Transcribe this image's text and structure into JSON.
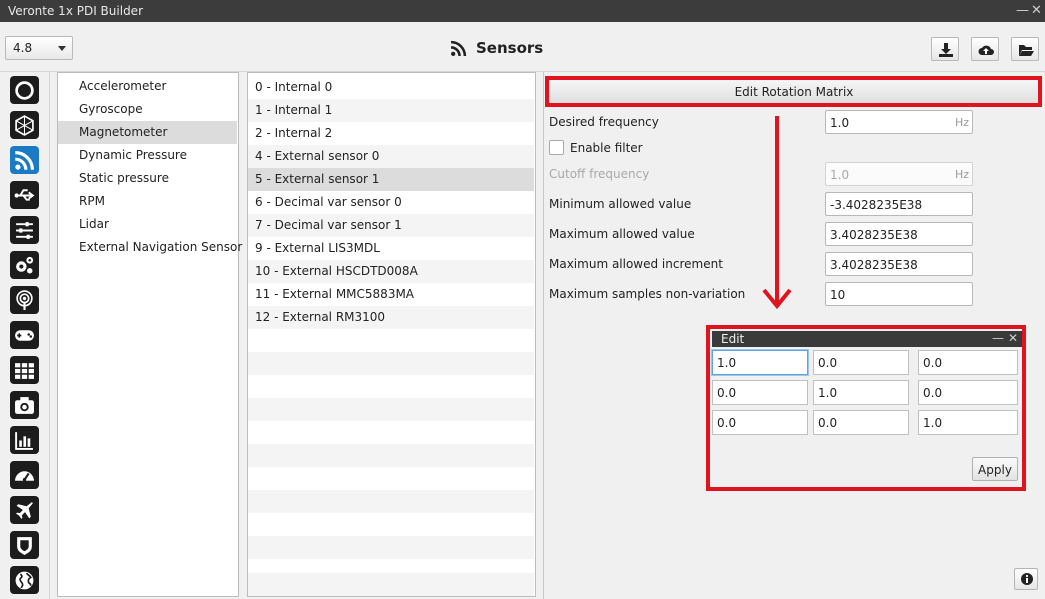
{
  "window": {
    "title": "Veronte 1x PDI Builder"
  },
  "header": {
    "version_value": "4.8",
    "page_title": "Sensors",
    "page_icon": "rss-icon",
    "buttons": [
      "download-icon",
      "cloud-upload-icon",
      "folder-open-icon"
    ]
  },
  "sidebar_icons": [
    "power-icon",
    "hexagon-icon",
    "rss-icon",
    "usb-icon",
    "sliders-icon",
    "gears-icon",
    "podcast-icon",
    "gamepad-icon",
    "grid-icon",
    "camera-icon",
    "bar-chart-icon",
    "dashboard-icon",
    "plane-icon",
    "shield-icon",
    "globe-icon"
  ],
  "categories": [
    {
      "label": "Accelerometer"
    },
    {
      "label": "Gyroscope"
    },
    {
      "label": "Magnetometer"
    },
    {
      "label": "Dynamic Pressure"
    },
    {
      "label": "Static pressure"
    },
    {
      "label": "RPM"
    },
    {
      "label": "Lidar"
    },
    {
      "label": "External Navigation Sensor"
    }
  ],
  "sensors": [
    {
      "label": "0 - Internal 0"
    },
    {
      "label": "1 - Internal 1"
    },
    {
      "label": "2 - Internal 2"
    },
    {
      "label": "4 - External sensor 0"
    },
    {
      "label": "5 - External sensor 1"
    },
    {
      "label": "6 - Decimal var sensor 0"
    },
    {
      "label": "7 - Decimal var sensor 1"
    },
    {
      "label": "9 - External LIS3MDL"
    },
    {
      "label": "10 - External HSCDTD008A"
    },
    {
      "label": "11 - External MMC5883MA"
    },
    {
      "label": "12 - External RM3100"
    }
  ],
  "settings": {
    "rotation_button": "Edit Rotation Matrix",
    "desired_frequency": {
      "label": "Desired frequency",
      "value": "1.0",
      "unit": "Hz"
    },
    "enable_filter": {
      "label": "Enable filter",
      "checked": false
    },
    "cutoff_frequency": {
      "label": "Cutoff frequency",
      "value": "1.0",
      "unit": "Hz"
    },
    "min_value": {
      "label": "Minimum allowed value",
      "value": "-3.4028235E38"
    },
    "max_value": {
      "label": "Maximum allowed value",
      "value": "3.4028235E38"
    },
    "max_increment": {
      "label": "Maximum allowed increment",
      "value": "3.4028235E38"
    },
    "max_samples": {
      "label": "Maximum samples non-variation",
      "value": "10"
    }
  },
  "edit_dialog": {
    "title": "Edit",
    "matrix": [
      [
        "1.0",
        "0.0",
        "0.0"
      ],
      [
        "0.0",
        "1.0",
        "0.0"
      ],
      [
        "0.0",
        "0.0",
        "1.0"
      ]
    ],
    "apply_label": "Apply"
  },
  "colors": {
    "highlight": "#e0141e",
    "active_icon": "#1a7bc4",
    "icon_bg": "#1c1c1c"
  }
}
